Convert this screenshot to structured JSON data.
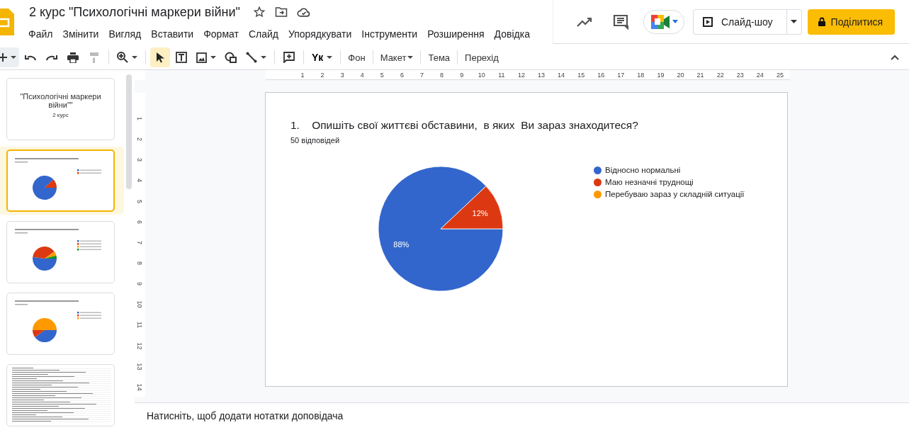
{
  "document": {
    "title": "2 курс \"Психологічні маркери війни\"",
    "menu": [
      "Файл",
      "Змінити",
      "Вигляд",
      "Вставити",
      "Формат",
      "Слайд",
      "Упорядкувати",
      "Інструменти",
      "Розширення",
      "Довідка"
    ]
  },
  "header_actions": {
    "slideshow_label": "Слайд-шоу",
    "share_label": "Поділитися"
  },
  "toolbar": {
    "tools": [
      {
        "kind": "add",
        "dropdown": true,
        "selected": false
      },
      {
        "kind": "undo",
        "dropdown": false,
        "selected": false
      },
      {
        "kind": "redo",
        "dropdown": false,
        "selected": false
      },
      {
        "kind": "print",
        "dropdown": false,
        "selected": false
      },
      {
        "kind": "paint",
        "dropdown": false,
        "selected": false
      },
      {
        "kind": "zoom",
        "dropdown": true,
        "selected": false
      },
      {
        "kind": "select",
        "dropdown": false,
        "selected": true
      },
      {
        "kind": "textbox",
        "dropdown": false,
        "selected": false
      },
      {
        "kind": "image",
        "dropdown": true,
        "selected": false
      },
      {
        "kind": "shape",
        "dropdown": false,
        "selected": false
      },
      {
        "kind": "line",
        "dropdown": true,
        "selected": false
      },
      {
        "kind": "comment",
        "dropdown": false,
        "selected": false
      },
      {
        "kind": "input",
        "label": "Yк",
        "dropdown": true,
        "selected": false
      }
    ],
    "text_buttons": [
      {
        "label": "Фон",
        "dropdown": false
      },
      {
        "label": "Макет",
        "dropdown": true
      },
      {
        "label": "Тема",
        "dropdown": false
      },
      {
        "label": "Перехід",
        "dropdown": false
      }
    ]
  },
  "filmstrip": [
    {
      "kind": "title",
      "selected": false,
      "title": "\"Психологічні маркери війни\"\"",
      "subtitle": "2 курс"
    },
    {
      "kind": "chart",
      "selected": true
    },
    {
      "kind": "chart",
      "selected": false
    },
    {
      "kind": "chart",
      "selected": false
    },
    {
      "kind": "table",
      "selected": false
    }
  ],
  "rulers": {
    "horizontal": [
      "1",
      "2",
      "3",
      "4",
      "5",
      "6",
      "7",
      "8",
      "9",
      "10",
      "11",
      "12",
      "13",
      "14",
      "15",
      "16",
      "17",
      "18",
      "19",
      "20",
      "21",
      "22",
      "23",
      "24",
      "25"
    ],
    "vertical": [
      "1",
      "2",
      "3",
      "4",
      "5",
      "6",
      "7",
      "8",
      "9",
      "10",
      "11",
      "12",
      "13",
      "14"
    ]
  },
  "slide": {
    "question": "1.    Опишіть свої життєві обставини,  в яких  Ви зараз знаходитеся?",
    "responses": "50 відповідей",
    "chart_data": {
      "type": "pie",
      "categories": [
        "Відносно нормальні",
        "Маю незначні труднощі",
        "Перебуваю зараз у складній ситуації"
      ],
      "values": [
        88,
        12,
        0
      ],
      "colors": [
        "#3366cc",
        "#dc3912",
        "#ff9900"
      ],
      "value_labels": [
        "88%",
        "12%",
        null
      ]
    }
  },
  "notes": {
    "placeholder": "Натисніть, щоб додати нотатки доповідача"
  }
}
